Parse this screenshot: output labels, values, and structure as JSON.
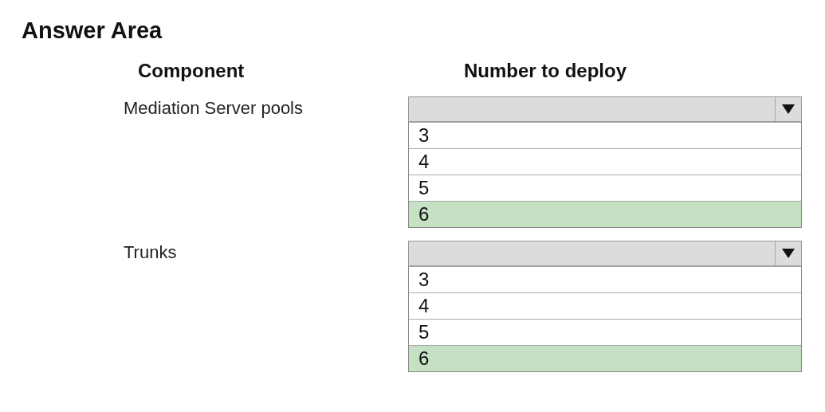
{
  "title": "Answer Area",
  "headers": [
    "Component",
    "Number to deploy"
  ],
  "rows": [
    {
      "label": "Mediation Server pools",
      "options": [
        {
          "text": "3",
          "selected": false
        },
        {
          "text": "4",
          "selected": false
        },
        {
          "text": "5",
          "selected": false
        },
        {
          "text": "6",
          "selected": true
        }
      ]
    },
    {
      "label": "Trunks",
      "options": [
        {
          "text": "3",
          "selected": false
        },
        {
          "text": "4",
          "selected": false
        },
        {
          "text": "5",
          "selected": false
        },
        {
          "text": "6",
          "selected": true
        }
      ]
    }
  ]
}
